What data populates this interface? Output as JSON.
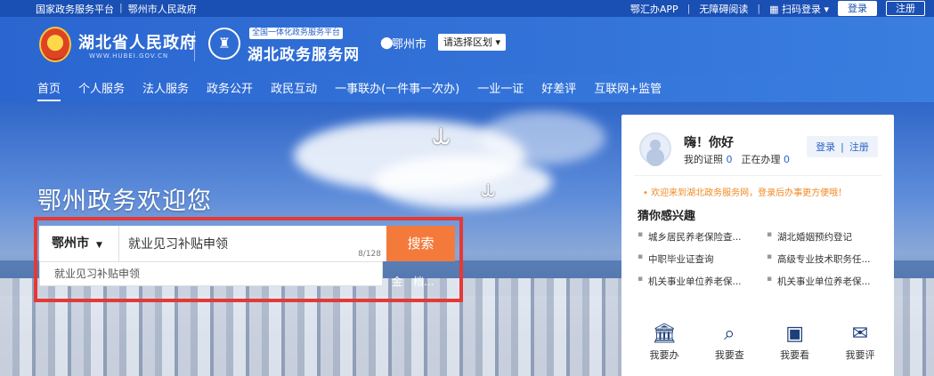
{
  "topbar": {
    "links": [
      "国家政务服务平台",
      "鄂州市人民政府"
    ],
    "sep": "|",
    "app": "鄂汇办APP",
    "accessibility": "无障碍阅读",
    "scan_login": "扫码登录",
    "login": "登录",
    "register": "注册"
  },
  "header": {
    "gov_title": "湖北省人民政府",
    "gov_url": "WWW.HUBEI.GOV.CN",
    "svc_tag": "全国一体化政务服务平台",
    "svc_title": "湖北政务服务网",
    "city": "鄂州市",
    "region_select": "请选择区划"
  },
  "nav": {
    "items": [
      "首页",
      "个人服务",
      "法人服务",
      "政务公开",
      "政民互动",
      "一事联办(一件事一次办)",
      "一业一证",
      "好差评",
      "互联网+监管"
    ]
  },
  "hero": {
    "welcome": "鄂州政务欢迎您"
  },
  "search": {
    "city": "鄂州市",
    "value": "就业见习补贴申领",
    "counter": "8/128",
    "button": "搜索",
    "suggestion": "就业见习补贴申领",
    "hot_tail": [
      "金",
      "档..."
    ]
  },
  "panel": {
    "greeting": "嗨！你好",
    "license_label": "我的证照",
    "license_count": "0",
    "processing_label": "正在办理",
    "processing_count": "0",
    "login": "登录",
    "register": "注册",
    "notice": "欢迎来到湖北政务服务网，登录后办事更方便哦！",
    "interest_title": "猜你感兴趣",
    "interests": [
      "城乡居民养老保险查...",
      "湖北婚姻预约登记",
      "中职毕业证查询",
      "高级专业技术职务任...",
      "机关事业单位养老保...",
      "机关事业单位养老保..."
    ],
    "quick": [
      {
        "label": "我要办",
        "icon": "bank-icon"
      },
      {
        "label": "我要查",
        "icon": "search-doc-icon"
      },
      {
        "label": "我要看",
        "icon": "monitor-icon"
      },
      {
        "label": "我要评",
        "icon": "chat-check-icon"
      }
    ]
  }
}
